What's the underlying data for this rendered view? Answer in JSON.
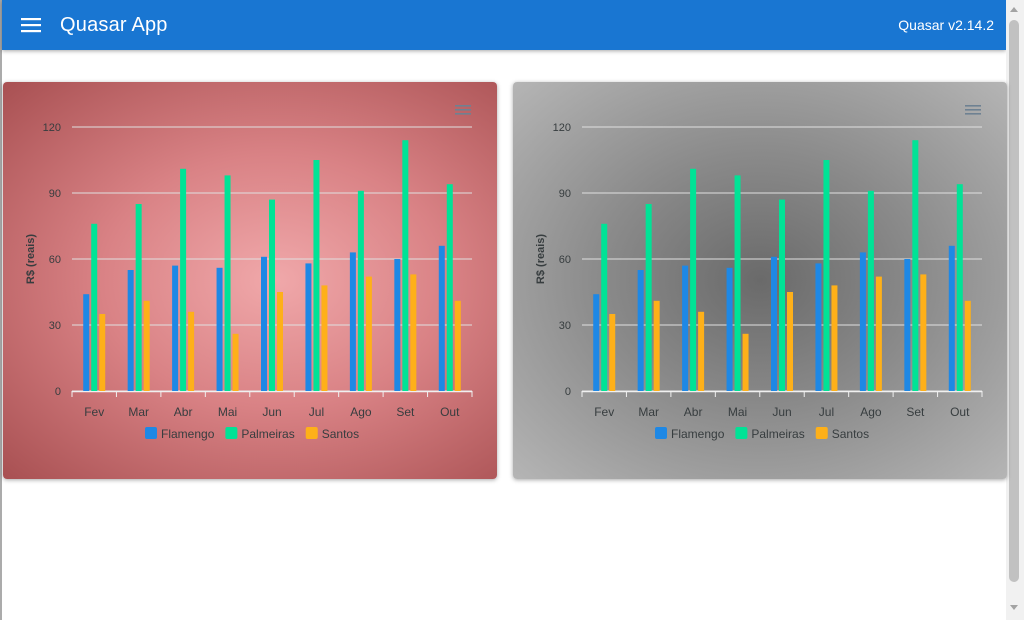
{
  "header": {
    "title": "Quasar App",
    "version": "Quasar v2.14.2"
  },
  "colors": {
    "header_bg": "#1976d2",
    "flamengo": "#1e88e5",
    "palmeiras": "#00e396",
    "santos": "#feb019"
  },
  "chart_data": [
    {
      "type": "bar",
      "title": "",
      "xlabel": "",
      "ylabel": "R$ (reais)",
      "ylim": [
        0,
        120
      ],
      "yticks": [
        0,
        30,
        60,
        90,
        120
      ],
      "grid": true,
      "legend_position": "bottom",
      "categories": [
        "Fev",
        "Mar",
        "Abr",
        "Mai",
        "Jun",
        "Jul",
        "Ago",
        "Set",
        "Out"
      ],
      "series": [
        {
          "name": "Flamengo",
          "color": "#1e88e5",
          "values": [
            44,
            55,
            57,
            56,
            61,
            58,
            63,
            60,
            66
          ]
        },
        {
          "name": "Palmeiras",
          "color": "#00e396",
          "values": [
            76,
            85,
            101,
            98,
            87,
            105,
            91,
            114,
            94
          ]
        },
        {
          "name": "Santos",
          "color": "#feb019",
          "values": [
            35,
            41,
            36,
            26,
            45,
            48,
            52,
            53,
            41
          ]
        }
      ]
    },
    {
      "type": "bar",
      "title": "",
      "xlabel": "",
      "ylabel": "R$ (reais)",
      "ylim": [
        0,
        120
      ],
      "yticks": [
        0,
        30,
        60,
        90,
        120
      ],
      "grid": true,
      "legend_position": "bottom",
      "categories": [
        "Fev",
        "Mar",
        "Abr",
        "Mai",
        "Jun",
        "Jul",
        "Ago",
        "Set",
        "Out"
      ],
      "series": [
        {
          "name": "Flamengo",
          "color": "#1e88e5",
          "values": [
            44,
            55,
            57,
            56,
            61,
            58,
            63,
            60,
            66
          ]
        },
        {
          "name": "Palmeiras",
          "color": "#00e396",
          "values": [
            76,
            85,
            101,
            98,
            87,
            105,
            91,
            114,
            94
          ]
        },
        {
          "name": "Santos",
          "color": "#feb019",
          "values": [
            35,
            41,
            36,
            26,
            45,
            48,
            52,
            53,
            41
          ]
        }
      ]
    }
  ]
}
